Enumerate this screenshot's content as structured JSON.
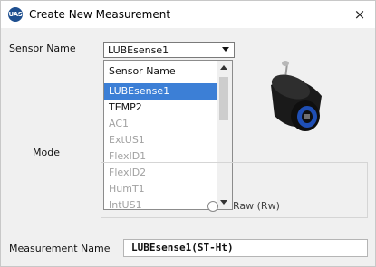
{
  "window": {
    "title": "Create New Measurement",
    "icon": "uas-logo",
    "app_icon_text": "UAS",
    "close_glyph": "×"
  },
  "sensor": {
    "label": "Sensor Name",
    "selected": "LUBEsense1",
    "dropdown": {
      "header": "Sensor Name",
      "options": [
        {
          "label": "LUBEsense1",
          "state": "selected"
        },
        {
          "label": "TEMP2",
          "state": "enabled"
        },
        {
          "label": "AC1",
          "state": "disabled"
        },
        {
          "label": "ExtUS1",
          "state": "disabled"
        },
        {
          "label": "FlexID1",
          "state": "disabled"
        },
        {
          "label": "FlexID2",
          "state": "disabled"
        },
        {
          "label": "HumT1",
          "state": "disabled"
        },
        {
          "label": "IntUS1",
          "state": "disabled"
        }
      ]
    }
  },
  "mode": {
    "label": "Mode",
    "visible_option": "Raw (Rw)"
  },
  "measurement": {
    "label": "Measurement Name",
    "value": "LUBEsense1(ST-Ht)"
  },
  "colors": {
    "selection": "#3c7fd6",
    "disabled_text": "#a2a2a2",
    "sensor_body": "#1a1a1a",
    "sensor_ring": "#1f4fb5"
  }
}
